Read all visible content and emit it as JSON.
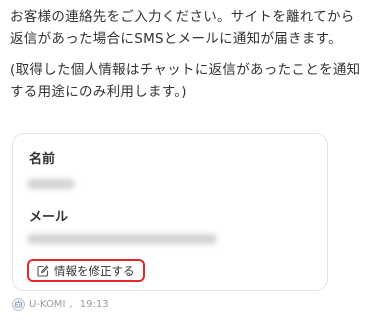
{
  "message": {
    "intro": "お客様の連絡先をご入力ください。サイトを離れてから返信があった場合にSMSとメールに通知が届きます。",
    "note": "(取得した個人情報はチャットに返信があったことを通知する用途にのみ利用します。)"
  },
  "contact_card": {
    "name_label": "名前",
    "email_label": "メール",
    "edit_button_label": "情報を修正する",
    "edit_icon": "edit-icon"
  },
  "meta": {
    "sender": "U-KOMI",
    "time": "19:13",
    "separator": ", ",
    "avatar_icon": "bot-icon"
  },
  "colors": {
    "highlight": "#e0282d",
    "card_border": "#e4e4e4",
    "text": "#333333",
    "meta_text": "#9a9a9a"
  }
}
